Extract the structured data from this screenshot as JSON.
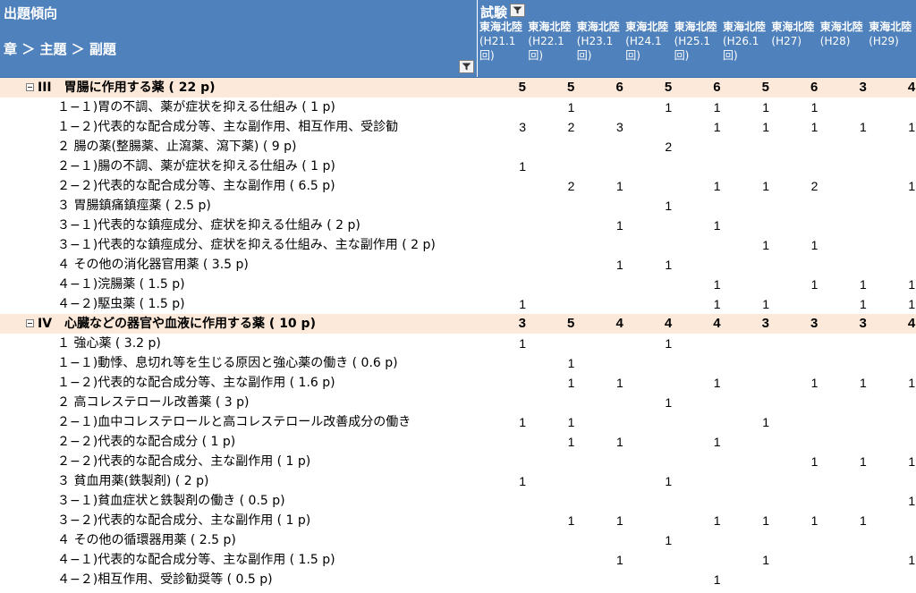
{
  "header": {
    "title": "出題傾向",
    "breadcrumb": "章 ＞ 主題 ＞ 副題",
    "exam_label": "試験",
    "columns": [
      {
        "name": "東海北陸",
        "sub": "(H21.1回)"
      },
      {
        "name": "東海北陸",
        "sub": "(H22.1回)"
      },
      {
        "name": "東海北陸",
        "sub": "(H23.1回)"
      },
      {
        "name": "東海北陸",
        "sub": "(H24.1回)"
      },
      {
        "name": "東海北陸",
        "sub": "(H25.1回)"
      },
      {
        "name": "東海北陸",
        "sub": "(H26.1回)"
      },
      {
        "name": "東海北陸",
        "sub": "(H27)"
      },
      {
        "name": "東海北陸",
        "sub": "(H28)"
      },
      {
        "name": "東海北陸",
        "sub": "(H29)"
      }
    ]
  },
  "chart_data": {
    "type": "table",
    "categories": [
      "東海北陸(H21.1回)",
      "東海北陸(H22.1回)",
      "東海北陸(H23.1回)",
      "東海北陸(H24.1回)",
      "東海北陸(H25.1回)",
      "東海北陸(H26.1回)",
      "東海北陸(H27)",
      "東海北陸(H28)",
      "東海北陸(H29)"
    ],
    "rows": [
      {
        "level": 0,
        "label": "III　胃腸に作用する薬 ( 22 p)",
        "values": [
          5,
          5,
          6,
          5,
          6,
          5,
          6,
          3,
          4
        ]
      },
      {
        "level": 1,
        "label": "１−１)胃の不調、薬が症状を抑える仕組み ( 1 p)",
        "values": [
          null,
          1,
          null,
          1,
          1,
          1,
          1,
          null,
          null
        ]
      },
      {
        "level": 1,
        "label": "１−２)代表的な配合成分等、主な副作用、相互作用、受診勧",
        "values": [
          3,
          2,
          3,
          null,
          1,
          1,
          1,
          1,
          1
        ]
      },
      {
        "level": 1,
        "label": "２ 腸の薬(整腸薬、止瀉薬、瀉下薬) ( 9 p)",
        "values": [
          null,
          null,
          null,
          2,
          null,
          null,
          null,
          null,
          null
        ]
      },
      {
        "level": 1,
        "label": "２−１)腸の不調、薬が症状を抑える仕組み ( 1 p)",
        "values": [
          1,
          null,
          null,
          null,
          null,
          null,
          null,
          null,
          null
        ]
      },
      {
        "level": 1,
        "label": "２−２)代表的な配合成分等、主な副作用 ( 6.5 p)",
        "values": [
          null,
          2,
          1,
          null,
          1,
          1,
          2,
          null,
          1
        ]
      },
      {
        "level": 1,
        "label": "３ 胃腸鎮痛鎮痙薬 ( 2.5 p)",
        "values": [
          null,
          null,
          null,
          1,
          null,
          null,
          null,
          null,
          null
        ]
      },
      {
        "level": 1,
        "label": "３−１)代表的な鎮痙成分、症状を抑える仕組み ( 2 p)",
        "values": [
          null,
          null,
          1,
          null,
          1,
          null,
          null,
          null,
          null
        ]
      },
      {
        "level": 1,
        "label": "３−１)代表的な鎮痙成分、症状を抑える仕組み、主な副作用 ( 2 p)",
        "values": [
          null,
          null,
          null,
          null,
          null,
          1,
          1,
          null,
          null
        ]
      },
      {
        "level": 1,
        "label": "４ その他の消化器官用薬 ( 3.5 p)",
        "values": [
          null,
          null,
          1,
          1,
          null,
          null,
          null,
          null,
          null
        ]
      },
      {
        "level": 1,
        "label": "４−１)浣腸薬 ( 1.5 p)",
        "values": [
          null,
          null,
          null,
          null,
          1,
          null,
          1,
          1,
          1
        ]
      },
      {
        "level": 1,
        "label": "４−２)駆虫薬 ( 1.5 p)",
        "values": [
          1,
          null,
          null,
          null,
          1,
          1,
          null,
          1,
          1
        ]
      },
      {
        "level": 0,
        "label": "IV　心臓などの器官や血液に作用する薬 ( 10 p)",
        "values": [
          3,
          5,
          4,
          4,
          4,
          3,
          3,
          3,
          4
        ]
      },
      {
        "level": 1,
        "label": "１ 強心薬 ( 3.2 p)",
        "values": [
          1,
          null,
          null,
          1,
          null,
          null,
          null,
          null,
          null
        ]
      },
      {
        "level": 1,
        "label": "１−１)動悸、息切れ等を生じる原因と強心薬の働き ( 0.6 p)",
        "values": [
          null,
          1,
          null,
          null,
          null,
          null,
          null,
          null,
          null
        ]
      },
      {
        "level": 1,
        "label": "１−２)代表的な配合成分等、主な副作用 ( 1.6 p)",
        "values": [
          null,
          1,
          1,
          null,
          1,
          null,
          1,
          1,
          1
        ]
      },
      {
        "level": 1,
        "label": "２ 高コレステロール改善薬 ( 3 p)",
        "values": [
          null,
          null,
          null,
          1,
          null,
          null,
          null,
          null,
          null
        ]
      },
      {
        "level": 1,
        "label": "２−１)血中コレステロールと高コレステロール改善成分の働き",
        "values": [
          1,
          1,
          null,
          null,
          null,
          1,
          null,
          null,
          null
        ]
      },
      {
        "level": 1,
        "label": "２−２)代表的な配合成分 ( 1 p)",
        "values": [
          null,
          1,
          1,
          null,
          1,
          null,
          null,
          null,
          null
        ]
      },
      {
        "level": 1,
        "label": "２−２)代表的な配合成分、主な副作用 ( 1 p)",
        "values": [
          null,
          null,
          null,
          null,
          null,
          null,
          1,
          1,
          1
        ]
      },
      {
        "level": 1,
        "label": "３ 貧血用薬(鉄製剤) ( 2 p)",
        "values": [
          1,
          null,
          null,
          1,
          null,
          null,
          null,
          null,
          null
        ]
      },
      {
        "level": 1,
        "label": "３−１)貧血症状と鉄製剤の働き ( 0.5 p)",
        "values": [
          null,
          null,
          null,
          null,
          null,
          null,
          null,
          null,
          1
        ]
      },
      {
        "level": 1,
        "label": "３−２)代表的な配合成分、主な副作用 ( 1 p)",
        "values": [
          null,
          1,
          1,
          null,
          1,
          1,
          1,
          1,
          null
        ]
      },
      {
        "level": 1,
        "label": "４ その他の循環器用薬 ( 2.5 p)",
        "values": [
          null,
          null,
          null,
          1,
          null,
          null,
          null,
          null,
          null
        ]
      },
      {
        "level": 1,
        "label": "４−１)代表的な配合成分等、主な副作用 ( 1.5 p)",
        "values": [
          null,
          null,
          1,
          null,
          null,
          1,
          null,
          null,
          1
        ]
      },
      {
        "level": 1,
        "label": "４−２)相互作用、受診勧奨等 ( 0.5 p)",
        "values": [
          null,
          null,
          null,
          null,
          1,
          null,
          null,
          null,
          null
        ]
      }
    ]
  },
  "colors": {
    "header_bg": "#4f81bd",
    "section_bg": "#fde9d9"
  }
}
